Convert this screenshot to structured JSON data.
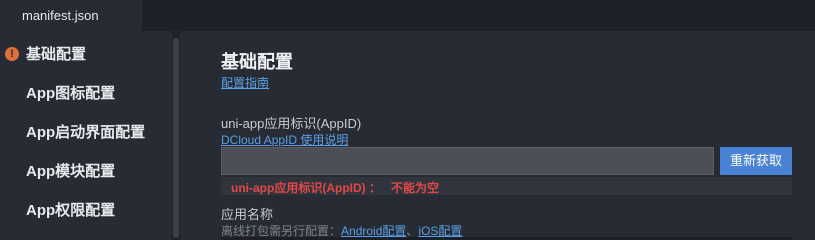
{
  "tab": {
    "label": "manifest.json"
  },
  "sidebar": {
    "items": [
      {
        "label": "基础配置",
        "warning": true
      },
      {
        "label": "App图标配置"
      },
      {
        "label": "App启动界面配置"
      },
      {
        "label": "App模块配置"
      },
      {
        "label": "App权限配置"
      }
    ],
    "warning_icon": "!"
  },
  "main": {
    "title": "基础配置",
    "guide_link": "配置指南",
    "appid": {
      "label": "uni-app应用标识(AppID)",
      "help_link": "DCloud AppID 使用说明",
      "value": "",
      "refresh_button": "重新获取",
      "error": "uni-app应用标识(AppID) ：   不能为空"
    },
    "app_name": {
      "label": "应用名称",
      "hint_prefix": "离线打包需另行配置：",
      "android_link": "Android配置",
      "separator": "、",
      "ios_link": "iOS配置"
    }
  },
  "colors": {
    "accent": "#4a83d6",
    "link": "#5aa0e8",
    "error": "#e04848",
    "warning": "#e0703a"
  }
}
